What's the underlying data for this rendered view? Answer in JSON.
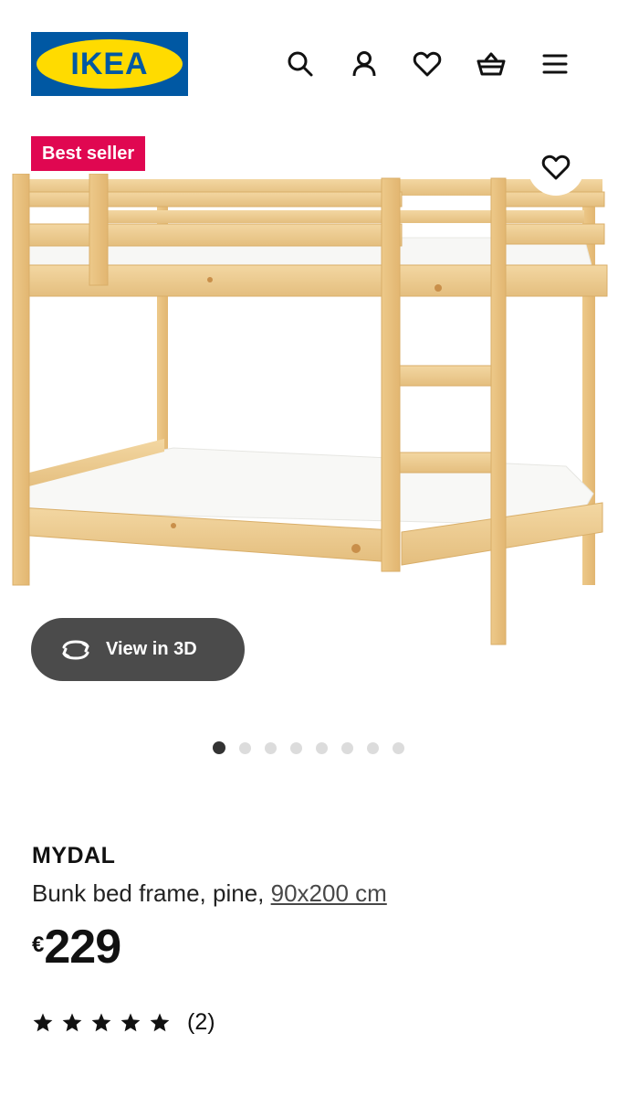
{
  "header": {
    "logo_text": "IKEA",
    "icons": [
      "search-icon",
      "account-icon",
      "heart-icon",
      "basket-icon",
      "menu-icon"
    ]
  },
  "gallery": {
    "badge": "Best seller",
    "view3d_label": "View in 3D",
    "dot_count": 8,
    "active_dot": 1
  },
  "product": {
    "name": "MYDAL",
    "description": "Bunk bed frame, pine, ",
    "size": "90x200 cm",
    "currency": "€",
    "price": "229",
    "rating": 5,
    "review_count": "(2)"
  },
  "colors": {
    "ikea_blue": "#0058a3",
    "ikea_yellow": "#ffdb00",
    "badge_red": "#e00751",
    "view3d_bg": "#4b4b4b"
  }
}
